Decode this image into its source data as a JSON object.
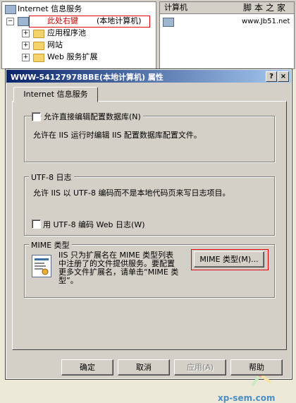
{
  "mmc": {
    "tree_root": "Internet 信息服务",
    "tree_server": "此处右键",
    "tree_server_suffix": "(本地计算机)",
    "tree_items": [
      "应用程序池",
      "网站",
      "Web 服务扩展"
    ],
    "list_header": "计算机",
    "list_item": "www.Jb51.net",
    "corner_watermark": "脚本之家"
  },
  "dialog": {
    "title": "WWW-54127978BBE(本地计算机) 属性",
    "help_btn": "?",
    "close_btn": "×",
    "tab_label": "Internet 信息服务",
    "metabase": {
      "checkbox_label": "允许直接编辑配置数据库(N)",
      "description": "允许在 IIS 运行时编辑 IIS 配置数据库配置文件。"
    },
    "utf8": {
      "group_title": "UTF-8 日志",
      "description": "允许 IIS 以 UTF-8 编码而不是本地代码页来写日志项目。",
      "checkbox_label": "用 UTF-8 编码 Web 日志(W)"
    },
    "mime": {
      "group_title": "MIME 类型",
      "description_lines": [
        "IIS 只为扩展名在 MIME 类型列表",
        "中注册了的文件提供服务。要配置",
        "更多文件扩展名，请单击“MIME 类",
        "型”。"
      ],
      "button": "MIME 类型(M)..."
    },
    "buttons": {
      "ok": "确定",
      "cancel": "取消",
      "apply": "应用(A)",
      "help": "帮助"
    },
    "watermark": "xp-sem.com"
  }
}
